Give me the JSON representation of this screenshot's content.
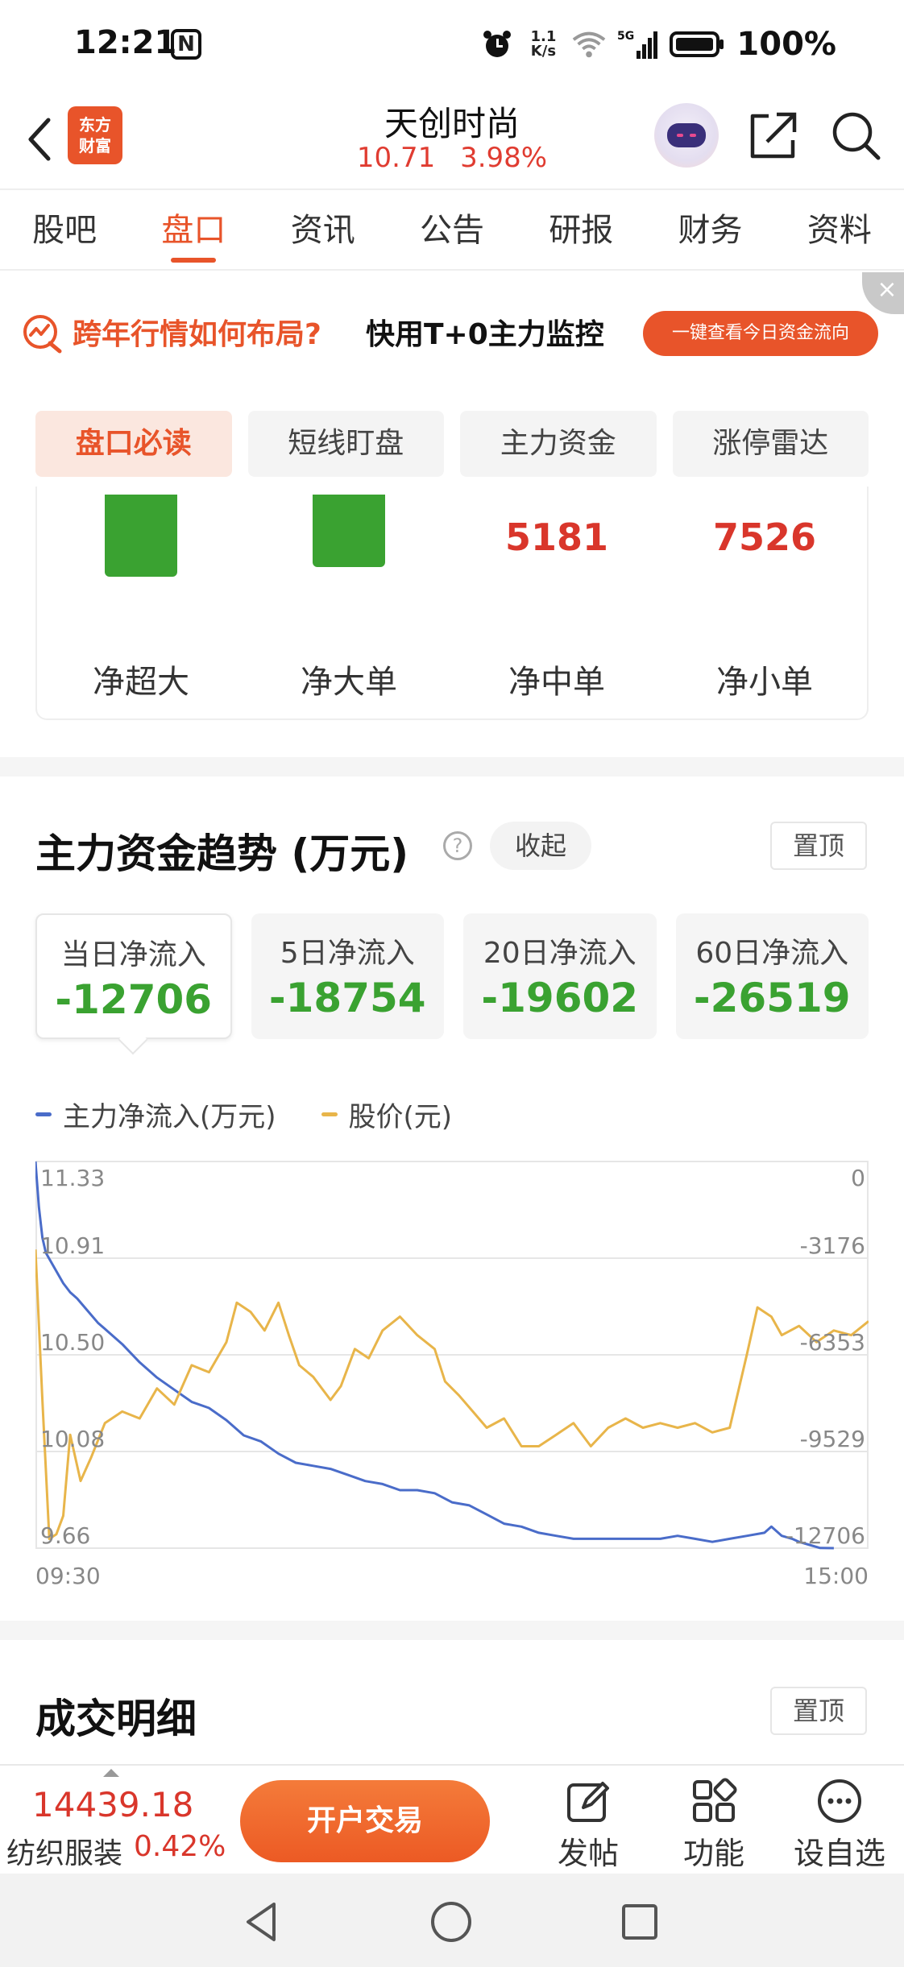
{
  "status_bar": {
    "time": "12:21",
    "nfc": "N",
    "net_speed_top": "1.1",
    "net_speed_bottom": "K/s",
    "signal": "5G",
    "battery": "100%"
  },
  "header": {
    "logo_line1": "东方",
    "logo_line2": "财富",
    "stock_name": "天创时尚",
    "price": "10.71",
    "change_pct": "3.98%"
  },
  "tabs": [
    {
      "label": "股吧",
      "active": false
    },
    {
      "label": "盘口",
      "active": true
    },
    {
      "label": "资讯",
      "active": false
    },
    {
      "label": "公告",
      "active": false
    },
    {
      "label": "研报",
      "active": false
    },
    {
      "label": "财务",
      "active": false
    },
    {
      "label": "资料",
      "active": false
    }
  ],
  "banner": {
    "text_orange": "跨年行情如何布局?",
    "text_black": "快用T+0主力监控",
    "cta": "一键查看今日资金流向",
    "close": "×"
  },
  "subtabs": [
    {
      "label": "盘口必读",
      "active": true
    },
    {
      "label": "短线盯盘",
      "active": false
    },
    {
      "label": "主力资金",
      "active": false
    },
    {
      "label": "涨停雷达",
      "active": false
    }
  ],
  "order_volume": [
    {
      "label": "净超大",
      "value": null,
      "bar_fraction": 0.64
    },
    {
      "label": "净大单",
      "value": null,
      "bar_fraction": 0.56
    },
    {
      "label": "净中单",
      "value": "5181",
      "bar_fraction": null
    },
    {
      "label": "净小单",
      "value": "7526",
      "bar_fraction": null
    }
  ],
  "trend": {
    "title": "主力资金趋势 (万元)",
    "help": "?",
    "collapse_label": "收起",
    "pin_label": "置顶",
    "cards": [
      {
        "label": "当日净流入",
        "value": "-12706",
        "active": true
      },
      {
        "label": "5日净流入",
        "value": "-18754",
        "active": false
      },
      {
        "label": "20日净流入",
        "value": "-19602",
        "active": false
      },
      {
        "label": "60日净流入",
        "value": "-26519",
        "active": false
      }
    ],
    "legend": [
      {
        "label": "主力净流入(万元)",
        "color": "#4a6cc9"
      },
      {
        "label": "股价(元)",
        "color": "#e8b54a"
      }
    ]
  },
  "chart_data": {
    "type": "line",
    "title": "",
    "x_start_label": "09:30",
    "x_end_label": "15:00",
    "x_range": [
      0,
      240
    ],
    "left_axis": {
      "label": "股价(元)",
      "ticks": [
        "11.33",
        "10.91",
        "10.50",
        "10.08",
        "9.66"
      ],
      "range": [
        9.66,
        11.33
      ]
    },
    "right_axis": {
      "label": "主力净流入(万元)",
      "ticks": [
        "0",
        "-3176",
        "-6353",
        "-9529",
        "-12706"
      ],
      "range": [
        -12706,
        0
      ]
    },
    "grid": true,
    "series": [
      {
        "name": "主力净流入(万元)",
        "color": "#4a6cc9",
        "axis": "right",
        "x": [
          0,
          1,
          2,
          3,
          5,
          8,
          10,
          12,
          15,
          18,
          20,
          25,
          30,
          35,
          40,
          45,
          50,
          55,
          60,
          65,
          70,
          75,
          80,
          85,
          90,
          95,
          100,
          105,
          110,
          115,
          120,
          125,
          130,
          135,
          140,
          145,
          150,
          155,
          160,
          165,
          170,
          175,
          180,
          185,
          190,
          195,
          200,
          205,
          210,
          212,
          215,
          218,
          220,
          223,
          226,
          230
        ],
        "y": [
          0,
          -1500,
          -2500,
          -3000,
          -3400,
          -4000,
          -4300,
          -4500,
          -4900,
          -5300,
          -5500,
          -6000,
          -6600,
          -7100,
          -7500,
          -7900,
          -8100,
          -8500,
          -9000,
          -9200,
          -9600,
          -9900,
          -10000,
          -10100,
          -10300,
          -10500,
          -10600,
          -10800,
          -10800,
          -10900,
          -11200,
          -11300,
          -11600,
          -11900,
          -12000,
          -12200,
          -12300,
          -12400,
          -12400,
          -12400,
          -12400,
          -12400,
          -12400,
          -12300,
          -12400,
          -12500,
          -12400,
          -12300,
          -12200,
          -12000,
          -12300,
          -12400,
          -12500,
          -12600,
          -12700,
          -12706
        ]
      },
      {
        "name": "股价(元)",
        "color": "#e8b54a",
        "axis": "left",
        "x": [
          0,
          2,
          4,
          6,
          8,
          10,
          13,
          16,
          20,
          25,
          30,
          35,
          40,
          45,
          50,
          55,
          58,
          62,
          66,
          70,
          73,
          76,
          80,
          85,
          88,
          92,
          96,
          100,
          105,
          110,
          115,
          118,
          122,
          126,
          130,
          135,
          140,
          145,
          150,
          155,
          160,
          165,
          170,
          175,
          180,
          185,
          190,
          195,
          200,
          205,
          208,
          212,
          215,
          220,
          225,
          230,
          235,
          240
        ],
        "y": [
          10.95,
          10.3,
          9.7,
          9.72,
          9.8,
          10.15,
          9.95,
          10.05,
          10.2,
          10.25,
          10.22,
          10.35,
          10.28,
          10.45,
          10.42,
          10.55,
          10.72,
          10.68,
          10.6,
          10.72,
          10.58,
          10.45,
          10.4,
          10.3,
          10.36,
          10.52,
          10.48,
          10.6,
          10.66,
          10.58,
          10.52,
          10.38,
          10.32,
          10.25,
          10.18,
          10.22,
          10.1,
          10.1,
          10.15,
          10.2,
          10.1,
          10.18,
          10.22,
          10.18,
          10.2,
          10.18,
          10.2,
          10.16,
          10.18,
          10.5,
          10.7,
          10.66,
          10.58,
          10.62,
          10.55,
          10.6,
          10.58,
          10.64
        ]
      }
    ]
  },
  "detail": {
    "title": "成交明细",
    "pin_label": "置顶"
  },
  "bottom_bar": {
    "index_value": "14439.18",
    "index_name": "纺织服装",
    "index_pct": "0.42%",
    "trade_label": "开户交易",
    "items": [
      {
        "label": "发帖",
        "icon": "edit-post-icon"
      },
      {
        "label": "功能",
        "icon": "grid-apps-icon"
      },
      {
        "label": "设自选",
        "icon": "more-dots-icon"
      }
    ]
  }
}
